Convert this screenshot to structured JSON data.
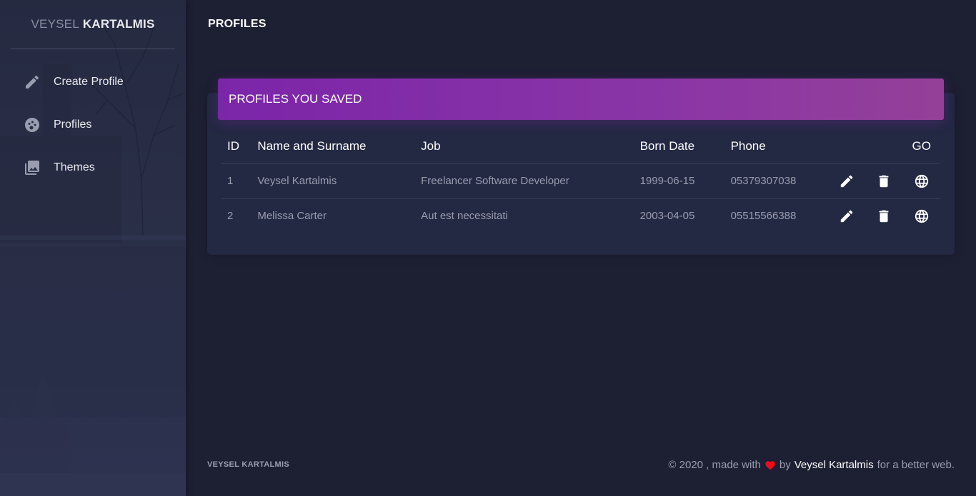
{
  "sidebar": {
    "brand_light": "VEYSEL",
    "brand_bold": "KARTALMIS",
    "items": [
      {
        "label": "Create Profile",
        "icon": "pencil-icon"
      },
      {
        "label": "Profiles",
        "icon": "face-icon"
      },
      {
        "label": "Themes",
        "icon": "image-gallery-icon"
      }
    ]
  },
  "header": {
    "title": "PROFILES"
  },
  "card": {
    "title": "PROFILES YOU SAVED",
    "columns": [
      "ID",
      "Name and Surname",
      "Job",
      "Born Date",
      "Phone",
      "GO"
    ],
    "rows": [
      {
        "id": "1",
        "name": "Veysel Kartalmis",
        "job": "Freelancer Software Developer",
        "born": "1999-06-15",
        "phone": "05379307038"
      },
      {
        "id": "2",
        "name": "Melissa Carter",
        "job": "Aut est necessitati",
        "born": "2003-04-05",
        "phone": "05515566388"
      }
    ]
  },
  "footer": {
    "left": "VEYSEL KARTALMIS",
    "copyright": "© 2020 , made with",
    "by": "by",
    "author": "Veysel Kartalmis",
    "tail": "for a better web."
  },
  "colors": {
    "background": "#1d1f33",
    "card": "#232843",
    "header_gradient_start": "#7b25a9",
    "header_gradient_end": "#944098",
    "heart": "#ec0c1a"
  }
}
